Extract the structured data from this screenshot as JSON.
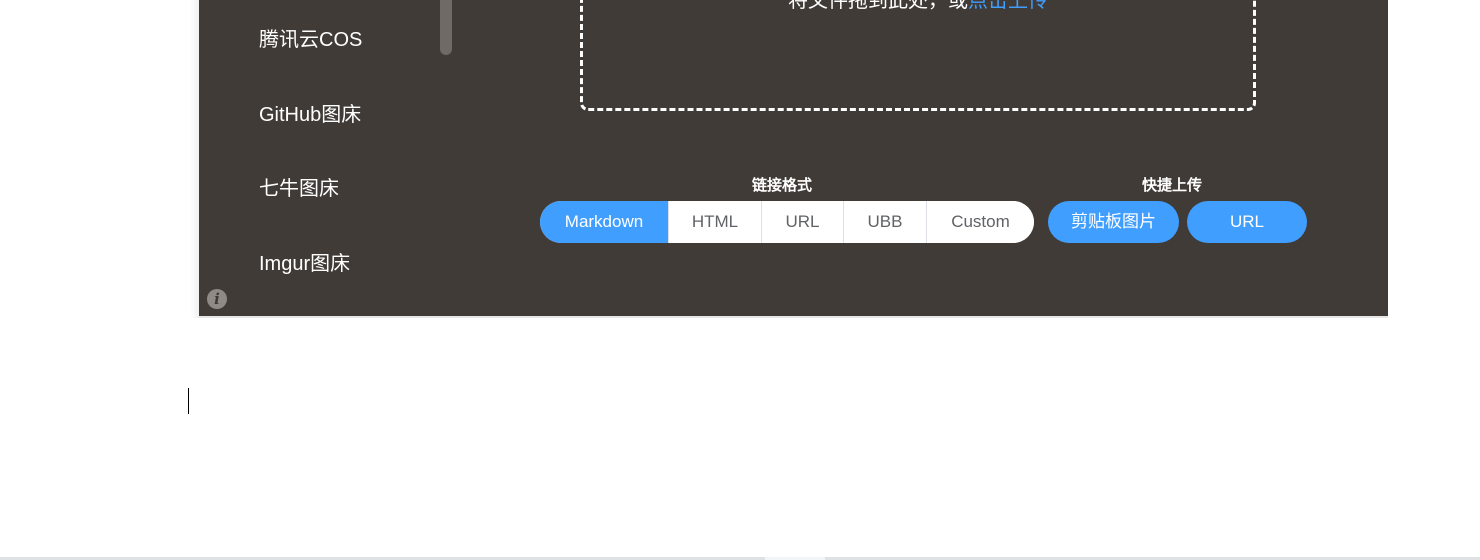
{
  "sidebar": {
    "items": [
      {
        "label": "腾讯云COS"
      },
      {
        "label": "GitHub图床"
      },
      {
        "label": "七牛图床"
      },
      {
        "label": "Imgur图床"
      }
    ]
  },
  "info": {
    "glyph": "i",
    "icon": "info-icon"
  },
  "drop_zone": {
    "hint_text": "将文件拖到此处，或",
    "link_text": "点击上传"
  },
  "link_format": {
    "label": "链接格式",
    "options": [
      "Markdown",
      "HTML",
      "URL",
      "UBB",
      "Custom"
    ],
    "selected": "Markdown"
  },
  "quick_upload": {
    "label": "快捷上传",
    "clipboard_button": "剪贴板图片",
    "url_button": "URL"
  },
  "colors": {
    "panel_background": "#403b36",
    "accent": "#409eff",
    "text": "#ffffff"
  }
}
